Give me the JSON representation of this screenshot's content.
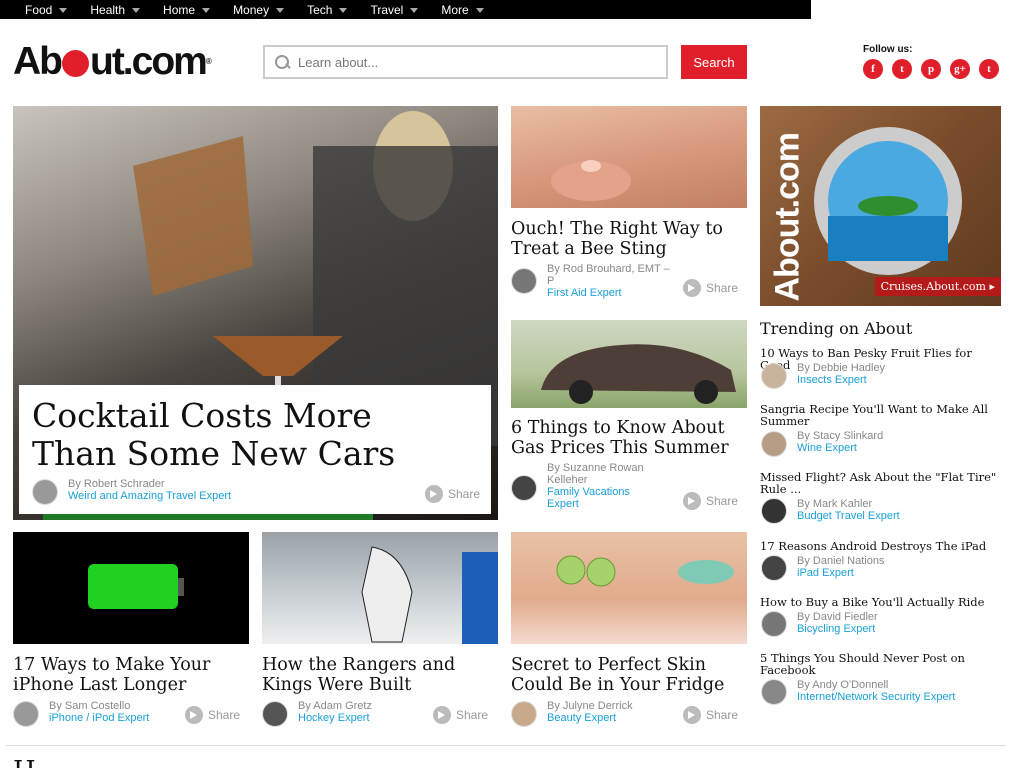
{
  "nav": [
    {
      "label": "Food"
    },
    {
      "label": "Health"
    },
    {
      "label": "Home"
    },
    {
      "label": "Money"
    },
    {
      "label": "Tech"
    },
    {
      "label": "Travel"
    },
    {
      "label": "More"
    }
  ],
  "logo": {
    "pre": "Ab",
    "post": "ut.com",
    "tm": "®"
  },
  "search": {
    "placeholder": "Learn about...",
    "button": "Search"
  },
  "follow": {
    "label": "Follow us:",
    "icons": [
      "facebook-icon",
      "twitter-icon",
      "pinterest-icon",
      "googleplus-icon",
      "tumblr-icon"
    ]
  },
  "hero": {
    "title_line1": "Cocktail Costs More",
    "title_line2": "Than Some New Cars",
    "author": "By Robert Schrader",
    "role": "Weird and Amazing Travel Expert",
    "share": "Share"
  },
  "articles": [
    {
      "title": "Ouch! The Right Way to Treat a Bee Sting",
      "author": "By Rod Brouhard, EMT – P",
      "role": "First Aid Expert",
      "share": "Share"
    },
    {
      "title": "6 Things to Know About Gas Prices This Summer",
      "author": "By Suzanne Rowan Kelleher",
      "role": "Family Vacations Expert",
      "share": "Share"
    },
    {
      "title": "17 Ways to Make Your iPhone Last Longer",
      "author": "By Sam Costello",
      "role": "iPhone / iPod Expert",
      "share": "Share"
    },
    {
      "title": "How the Rangers and Kings Were Built",
      "author": "By Adam Gretz",
      "role": "Hockey Expert",
      "share": "Share"
    },
    {
      "title": "Secret to Perfect Skin Could Be in Your Fridge",
      "author": "By Julyne Derrick",
      "role": "Beauty Expert",
      "share": "Share"
    }
  ],
  "ad": {
    "brand": "About.com",
    "link": "Cruises.About.com ▸"
  },
  "trending": {
    "heading": "Trending on About",
    "items": [
      {
        "title": "10 Ways to Ban Pesky Fruit Flies for Good",
        "author": "By Debbie Hadley",
        "role": "Insects Expert"
      },
      {
        "title": "Sangria Recipe You'll Want to Make All Summer",
        "author": "By Stacy Slinkard",
        "role": "Wine Expert"
      },
      {
        "title": "Missed Flight? Ask About the \"Flat Tire\" Rule ...",
        "author": "By Mark Kahler",
        "role": "Budget Travel Expert"
      },
      {
        "title": "17 Reasons Android Destroys The iPad",
        "author": "By Daniel Nations",
        "role": "iPad Expert"
      },
      {
        "title": "How to Buy a Bike You'll Actually Ride",
        "author": "By David Fiedler",
        "role": "Bicycling Expert"
      },
      {
        "title": "5 Things You Should Never Post on Facebook",
        "author": "By Andy O'Donnell",
        "role": "Internet/Network Security Expert"
      }
    ]
  },
  "bottom": {
    "heading": "H"
  }
}
